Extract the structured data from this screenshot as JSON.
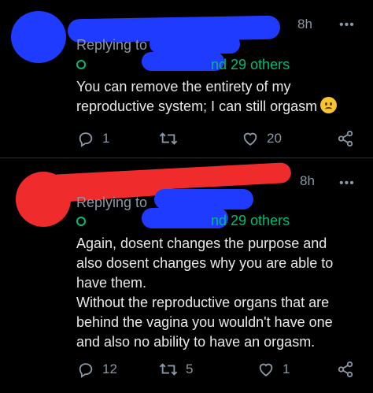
{
  "colors": {
    "background": "#000000",
    "text": "#e7e9ea",
    "muted": "#8b98a5",
    "mention_green": "#00ba7c",
    "scribble_blue": "#1f3bff",
    "scribble_red": "#f02b2b"
  },
  "tweets": [
    {
      "time": "8h",
      "replying_label": "Replying to",
      "others": "nd 29 others",
      "lines": [
        "You can remove the entirety of my",
        "reproductive system; I can still orgasm"
      ],
      "emoji": "worried-face",
      "actions": {
        "reply": "1",
        "retweet": "",
        "like": "20",
        "share": ""
      }
    },
    {
      "time": "8h",
      "replying_label": "Replying to",
      "others": "nd 29 others",
      "lines": [
        "Again, dosent changes the purpose and",
        "also dosent changes why you are able to",
        "have them.",
        "Without the reproductive organs that are",
        "behind the vagina you wouldn't have one",
        "and also no ability to have an orgasm."
      ],
      "actions": {
        "reply": "12",
        "retweet": "5",
        "like": "1",
        "share": ""
      }
    }
  ]
}
